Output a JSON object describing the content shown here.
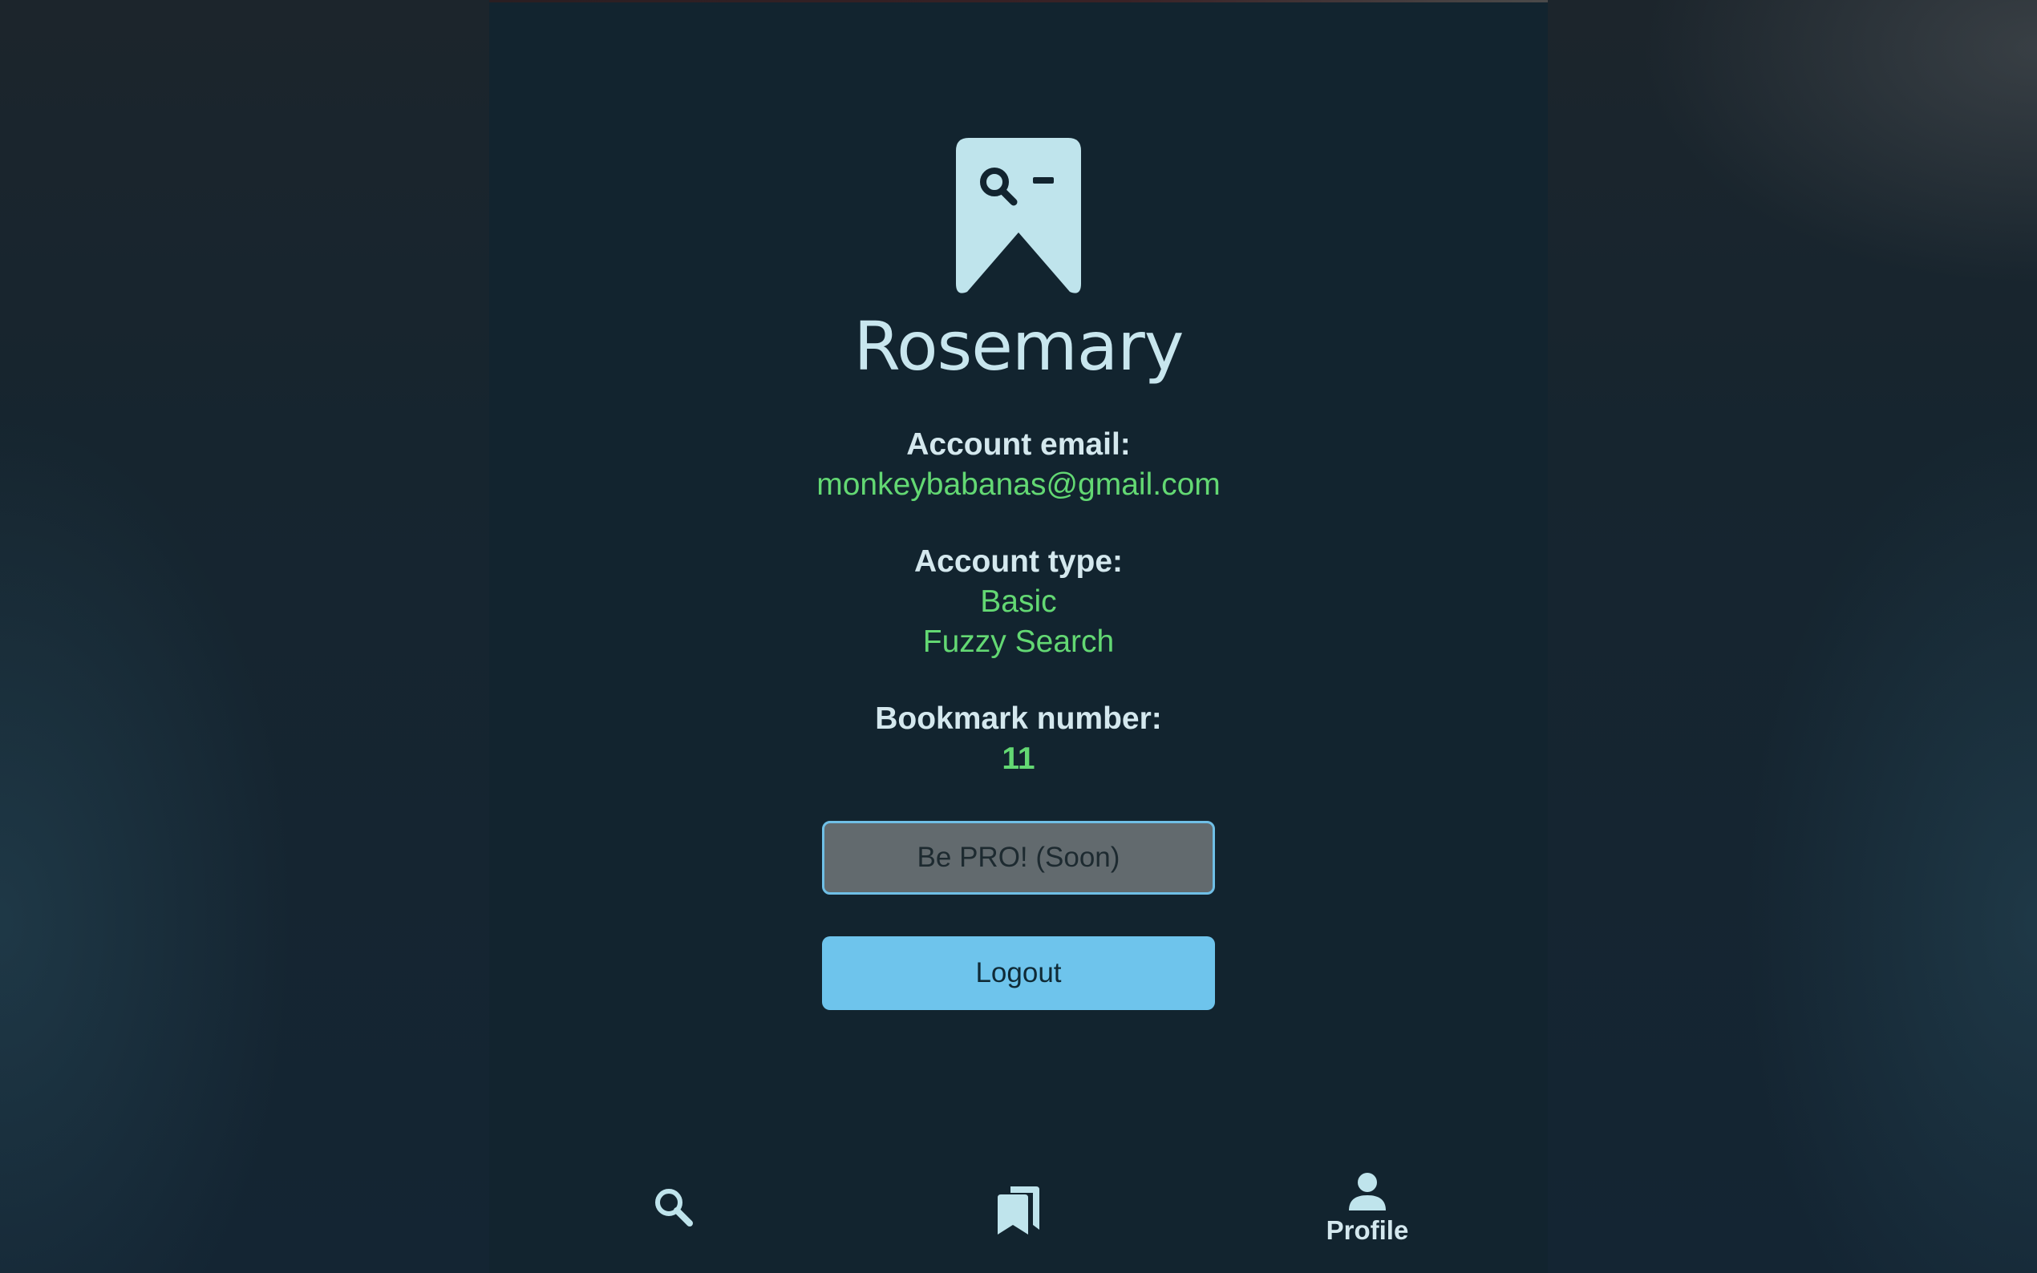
{
  "app": {
    "title": "Rosemary",
    "logo_icon": "bookmark-search-logo-icon"
  },
  "profile": {
    "email_label": "Account email:",
    "email_value": "monkeybabanas@gmail.com",
    "type_label": "Account type:",
    "type_values": [
      "Basic",
      "Fuzzy Search"
    ],
    "bookmark_label": "Bookmark number:",
    "bookmark_value": "11"
  },
  "buttons": {
    "pro_label": "Be PRO! (Soon)",
    "logout_label": "Logout"
  },
  "nav": {
    "items": [
      {
        "icon": "search-icon",
        "label": ""
      },
      {
        "icon": "bookmarks-icon",
        "label": ""
      },
      {
        "icon": "person-icon",
        "label": "Profile",
        "active": true
      }
    ]
  },
  "colors": {
    "panel_bg": "#12242f",
    "accent_green": "#63d873",
    "accent_blue": "#6ec4ec",
    "text_light": "#d4e8ee",
    "logo_color": "#bfe4ec"
  }
}
